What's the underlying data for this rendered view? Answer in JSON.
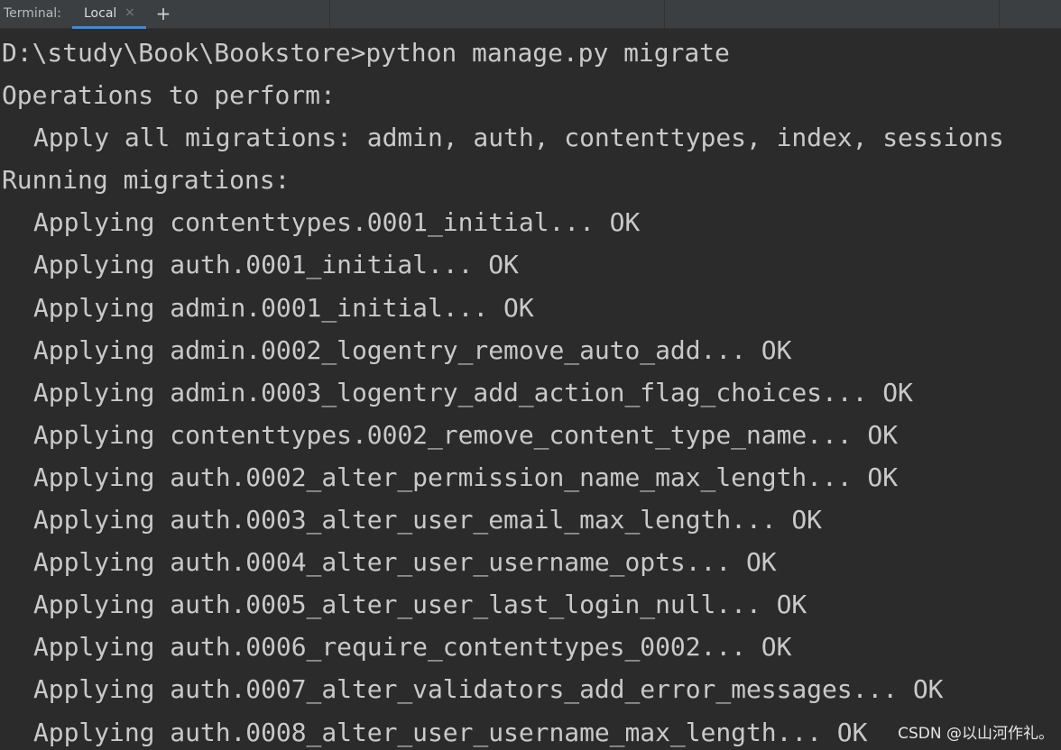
{
  "tabbar": {
    "label": "Terminal:",
    "tabs": [
      {
        "label": "Local",
        "active": true
      }
    ],
    "close_glyph": "×",
    "add_glyph": "+"
  },
  "terminal": {
    "lines": [
      {
        "text": "D:\\study\\Book\\Bookstore>python manage.py migrate",
        "indent": false
      },
      {
        "text": "Operations to perform:",
        "indent": false
      },
      {
        "text": "Apply all migrations: admin, auth, contenttypes, index, sessions",
        "indent": true
      },
      {
        "text": "Running migrations:",
        "indent": false
      },
      {
        "text": "Applying contenttypes.0001_initial... OK",
        "indent": true
      },
      {
        "text": "Applying auth.0001_initial... OK",
        "indent": true
      },
      {
        "text": "Applying admin.0001_initial... OK",
        "indent": true
      },
      {
        "text": "Applying admin.0002_logentry_remove_auto_add... OK",
        "indent": true
      },
      {
        "text": "Applying admin.0003_logentry_add_action_flag_choices... OK",
        "indent": true
      },
      {
        "text": "Applying contenttypes.0002_remove_content_type_name... OK",
        "indent": true
      },
      {
        "text": "Applying auth.0002_alter_permission_name_max_length... OK",
        "indent": true
      },
      {
        "text": "Applying auth.0003_alter_user_email_max_length... OK",
        "indent": true
      },
      {
        "text": "Applying auth.0004_alter_user_username_opts... OK",
        "indent": true
      },
      {
        "text": "Applying auth.0005_alter_user_last_login_null... OK",
        "indent": true
      },
      {
        "text": "Applying auth.0006_require_contenttypes_0002... OK",
        "indent": true
      },
      {
        "text": "Applying auth.0007_alter_validators_add_error_messages... OK",
        "indent": true
      },
      {
        "text": "Applying auth.0008_alter_user_username_max_length... OK",
        "indent": true
      }
    ]
  },
  "watermark": "CSDN @以山河作礼。",
  "colors": {
    "background": "#2b2b2b",
    "tabbar": "#3c3f41",
    "active_tab_underline": "#4a88c7",
    "text": "#c9c9c9"
  }
}
